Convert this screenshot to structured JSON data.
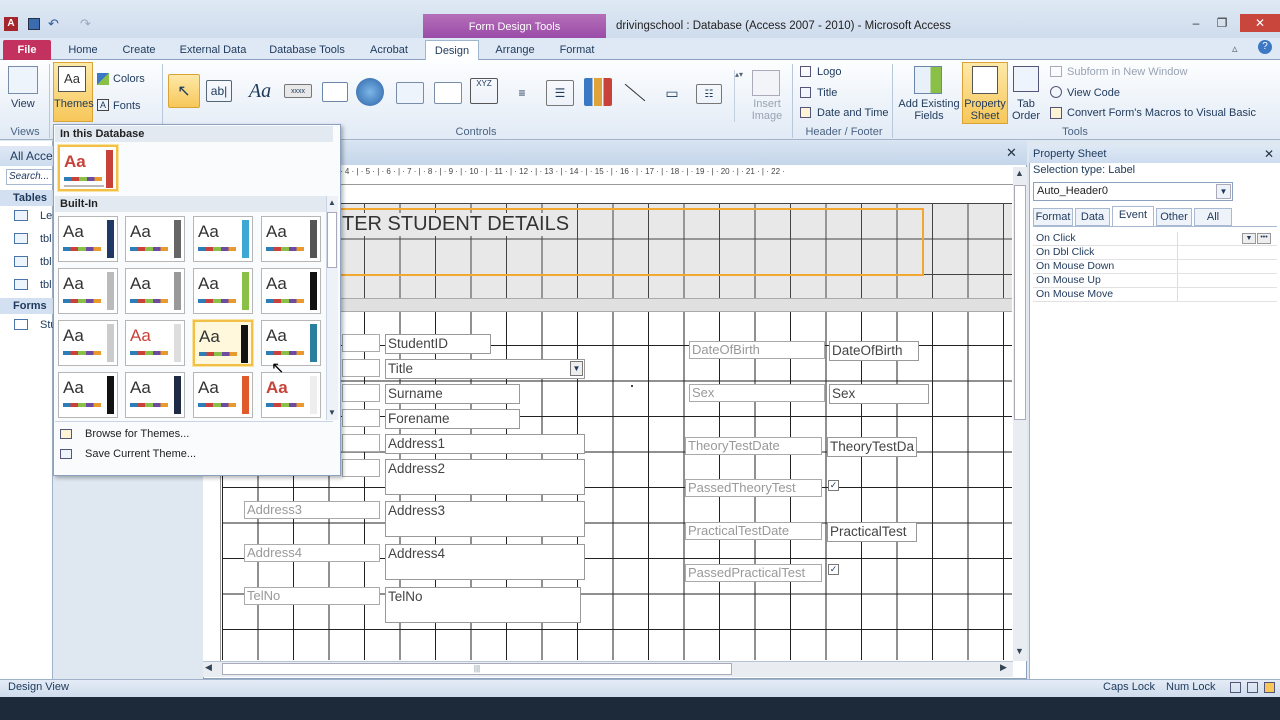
{
  "window": {
    "title": "drivingschool : Database (Access 2007 - 2010)  -  Microsoft Access",
    "context_group": "Form Design Tools",
    "buttons": [
      "–",
      "❐",
      "✕"
    ]
  },
  "tabs": [
    "File",
    "Home",
    "Create",
    "External Data",
    "Database Tools",
    "Acrobat",
    "Design",
    "Arrange",
    "Format"
  ],
  "ribbon": {
    "views": {
      "label": "View",
      "group": "Views"
    },
    "themes": {
      "themes_label": "Themes",
      "colors_label": "Colors",
      "fonts_label": "Fonts"
    },
    "controls_group": "Controls",
    "insert_image": "Insert Image",
    "header_footer": {
      "logo": "Logo",
      "title": "Title",
      "date_time": "Date and Time",
      "group": "Header / Footer"
    },
    "tools": {
      "add_existing": "Add Existing Fields",
      "property_sheet": "Property Sheet",
      "tab_order": "Tab Order",
      "subform": "Subform in New Window",
      "view_code": "View Code",
      "convert": "Convert Form's Macros to Visual Basic",
      "group": "Tools"
    }
  },
  "nav": {
    "header": "All Acce",
    "search": "Search...",
    "tables_header": "Tables",
    "tables": [
      "Les",
      "tbl",
      "tbl",
      "tbl"
    ],
    "forms_header": "Forms",
    "forms": [
      "Stu"
    ]
  },
  "theme_panel": {
    "in_db": "In this Database",
    "builtin": "Built-In",
    "browse": "Browse for Themes...",
    "save": "Save Current Theme...",
    "aa": "Aa"
  },
  "ruler_text": "· 4 · | · 5 · | · 6 · | · 7 · | · 8 · | · 9 · | · 10 · | · 11 · | · 12 · | · 13 · | · 14 · | · 15 · | · 16 · | · 17 · | · 18 · | · 19 · | · 20 · | · 21 · | · 22 ·",
  "form": {
    "header_text": "TER STUDENT DETAILS",
    "fields": {
      "studentid": "StudentID",
      "title": "Title",
      "surname": "Surname",
      "forename": "Forename",
      "address1": "Address1",
      "address2": "Address2",
      "address3_label": "Address3",
      "address3": "Address3",
      "address4_label": "Address4",
      "address4": "Address4",
      "telno_label": "TelNo",
      "telno": "TelNo",
      "dob_label": "DateOfBirth",
      "dob": "DateOfBirth",
      "sex_label": "Sex",
      "sex": "Sex",
      "theory_date_label": "TheoryTestDate",
      "theory_date": "TheoryTestDa",
      "passed_theory_label": "PassedTheoryTest",
      "practical_date_label": "PracticalTestDate",
      "practical_date": "PracticalTest",
      "passed_practical_label": "PassedPracticalTest",
      "check": "✓"
    }
  },
  "property_sheet": {
    "title": "Property Sheet",
    "selection_type": "Selection type:  Label",
    "selected": "Auto_Header0",
    "tabs": [
      "Format",
      "Data",
      "Event",
      "Other",
      "All"
    ],
    "active_tab": "Event",
    "rows": [
      "On Click",
      "On Dbl Click",
      "On Mouse Down",
      "On Mouse Up",
      "On Mouse Move"
    ]
  },
  "status": {
    "left": "Design View",
    "caps": "Caps Lock",
    "num": "Num Lock"
  },
  "colors": {
    "file_tab": "#c3315f",
    "context": "#9a4ca8",
    "selection": "#f2a830"
  }
}
